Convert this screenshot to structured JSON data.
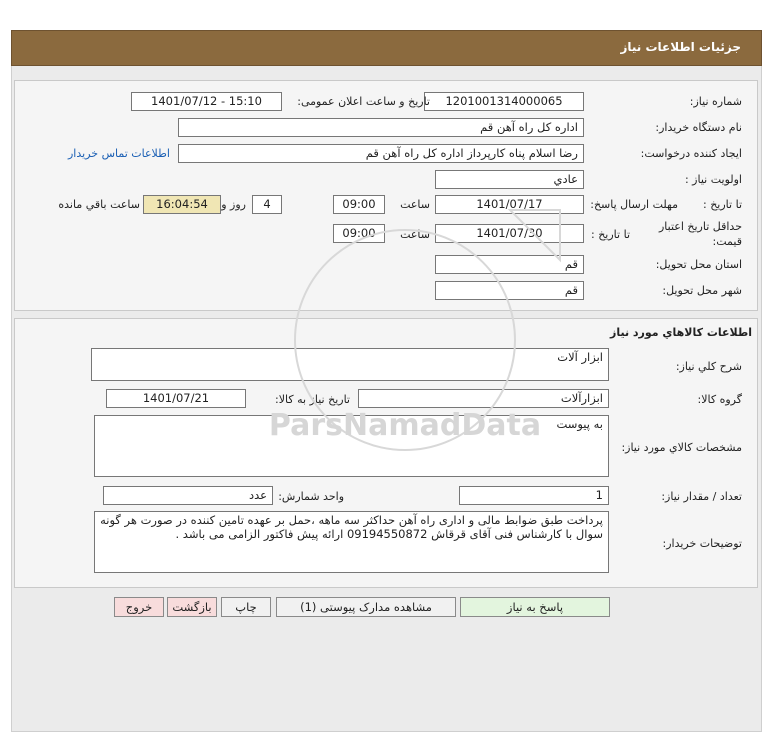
{
  "header": {
    "title": "جزئیات اطلاعات نیاز"
  },
  "details": {
    "need_number_label": "شماره نیاز:",
    "need_number": "1201001314000065",
    "announce_label": "تاریخ و ساعت اعلان عمومی:",
    "announce_value": "1401/07/12 - 15:10",
    "buyer_org_label": "نام دستگاه خریدار:",
    "buyer_org": "اداره کل  راه آهن قم",
    "requester_label": "ایجاد کننده درخواست:",
    "requester": "رضا اسلام پناه کارپرداز اداره کل  راه آهن قم",
    "contact_link": "اطلاعات تماس خریدار",
    "priority_label": "اولویت نیاز :",
    "priority": "عادي",
    "send_deadline_label": "مهلت ارسال پاسخ:",
    "to_date_label": "تا تاریخ :",
    "send_date": "1401/07/17",
    "time_label": "ساعت",
    "send_time": "09:00",
    "days_value": "4",
    "days_label": "روز و",
    "remaining_time": "16:04:54",
    "remaining_label": "ساعت باقي مانده",
    "validity_label_1": "حداقل تاریخ اعتبار",
    "validity_label_2": "قیمت:",
    "validity_date": "1401/07/30",
    "validity_time": "09:00",
    "province_label": "استان محل تحویل:",
    "province": "قم",
    "city_label": "شهر محل تحویل:",
    "city": "قم"
  },
  "goods": {
    "section_title": "اطلاعات کالاهاي مورد نياز",
    "desc_label": "شرح کلي نياز:",
    "desc": "ابزار آلات",
    "group_label": "گروه کالا:",
    "group": "ابزارآلات",
    "need_date_label": "تاریخ نیاز به کالا:",
    "need_date": "1401/07/21",
    "specs_label": "مشخصات کالاي مورد نياز:",
    "specs": "به پیوست",
    "qty_label": "تعداد / مقدار نیاز:",
    "qty": "1",
    "unit_label": "واحد شمارش:",
    "unit": "عدد",
    "notes_label": "توضیحات خریدار:",
    "notes": "پرداخت طبق ضوابط مالی و اداری راه آهن حداکثر سه ماهه ،حمل بر عهده تامین کننده در صورت هر گونه سوال با کارشناس فنی آقای قرقاش 09194550872 ارائه پیش فاکتور الزامی می باشد ."
  },
  "buttons": {
    "reply": "پاسخ به نیاز",
    "attachments": "مشاهده مدارک پیوستی (1)",
    "print": "چاپ",
    "back": "بازگشت",
    "exit": "خروج"
  },
  "colors": {
    "header_bg": "#8b6a3e",
    "remaining_bg": "#f0e6b4",
    "reply_btn": "#e3f5de",
    "exit_btn": "#f8dcdc",
    "link": "#1a5fb4"
  }
}
